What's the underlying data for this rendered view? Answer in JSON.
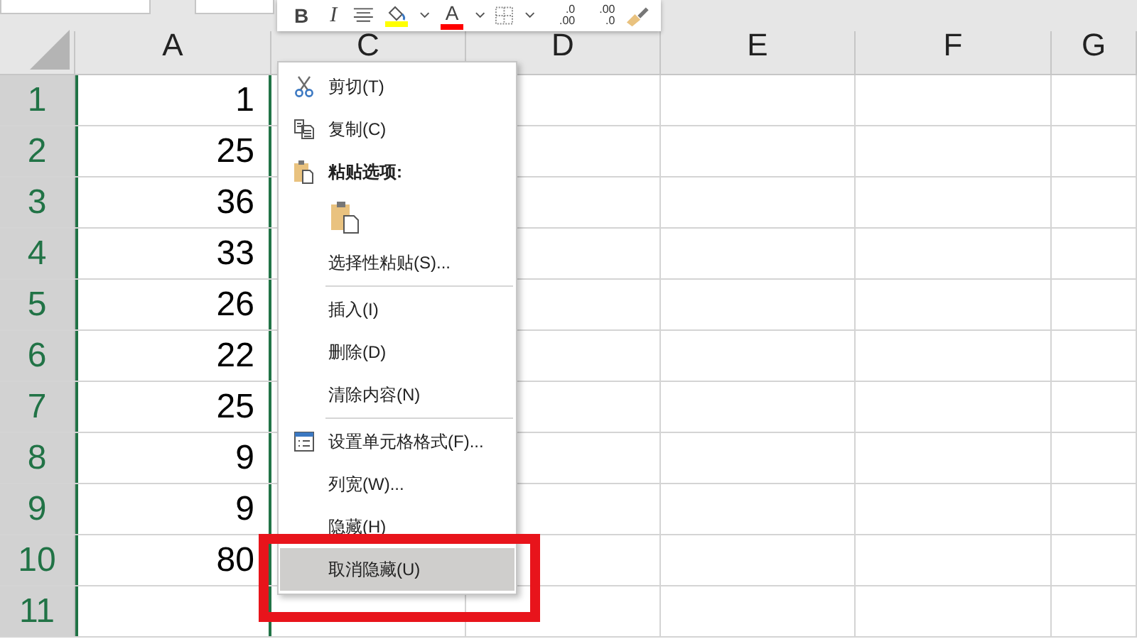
{
  "columns": [
    {
      "label": "A"
    },
    {
      "label": "C"
    },
    {
      "label": "D"
    },
    {
      "label": "E"
    },
    {
      "label": "F"
    },
    {
      "label": "G"
    }
  ],
  "rows": [
    {
      "label": "1",
      "value": "1"
    },
    {
      "label": "2",
      "value": "25"
    },
    {
      "label": "3",
      "value": "36"
    },
    {
      "label": "4",
      "value": "33"
    },
    {
      "label": "5",
      "value": "26"
    },
    {
      "label": "6",
      "value": "22"
    },
    {
      "label": "7",
      "value": "25"
    },
    {
      "label": "8",
      "value": "9"
    },
    {
      "label": "9",
      "value": "9"
    },
    {
      "label": "10",
      "value": "80"
    },
    {
      "label": "11",
      "value": ""
    }
  ],
  "mini_toolbar": [
    {
      "kind": "bold",
      "label": "B"
    },
    {
      "kind": "italic",
      "label": "I"
    },
    {
      "kind": "align"
    },
    {
      "kind": "fill",
      "color": "#ffff00"
    },
    {
      "kind": "caret"
    },
    {
      "kind": "font-color",
      "label": "A",
      "color": "#ff0000"
    },
    {
      "kind": "caret"
    },
    {
      "kind": "borders"
    },
    {
      "kind": "caret"
    },
    {
      "kind": "decimal-increase",
      "top": ".0",
      "bottom": ".00"
    },
    {
      "kind": "decimal-decrease",
      "top": ".00",
      "bottom": ".0"
    },
    {
      "kind": "format-painter"
    }
  ],
  "context_menu": [
    {
      "kind": "cut",
      "label": "剪切(T)",
      "selected": false
    },
    {
      "kind": "copy",
      "label": "复制(C)",
      "selected": false
    },
    {
      "kind": "header",
      "label": "粘贴选项:"
    },
    {
      "kind": "paste-option"
    },
    {
      "kind": "item",
      "label": "选择性粘贴(S)...",
      "selected": false
    },
    {
      "kind": "separator"
    },
    {
      "kind": "item",
      "label": "插入(I)",
      "selected": false
    },
    {
      "kind": "item",
      "label": "删除(D)",
      "selected": false
    },
    {
      "kind": "item",
      "label": "清除内容(N)",
      "selected": false
    },
    {
      "kind": "separator"
    },
    {
      "kind": "format",
      "label": "设置单元格格式(F)...",
      "selected": false
    },
    {
      "kind": "item",
      "label": "列宽(W)...",
      "selected": false
    },
    {
      "kind": "item",
      "label": "隐藏(H)",
      "selected": false
    },
    {
      "kind": "item",
      "label": "取消隐藏(U)",
      "selected": true
    }
  ]
}
